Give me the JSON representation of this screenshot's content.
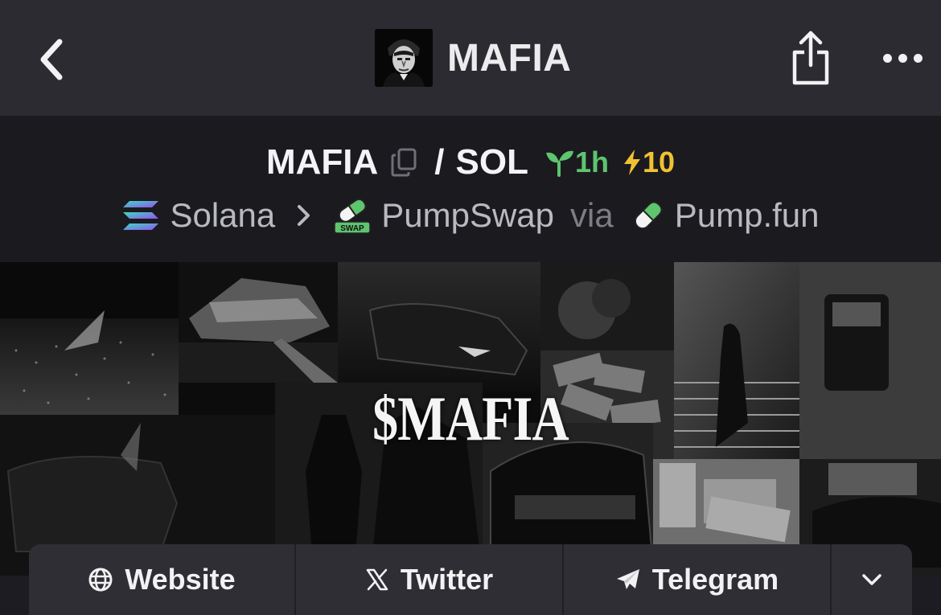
{
  "header": {
    "title": "MAFIA",
    "back_icon": "chevron-left-icon",
    "share_icon": "share-icon",
    "more_icon": "more-horizontal-icon"
  },
  "pair": {
    "base": "MAFIA",
    "separator": "/",
    "quote": "SOL",
    "age": "1h",
    "boosts": "10",
    "age_color": "#5fc46e",
    "boost_color": "#f0c232"
  },
  "chain": {
    "network": "Solana",
    "dex": "PumpSwap",
    "via_label": "via",
    "launchpad": "Pump.fun",
    "dex_badge": "SWAP"
  },
  "banner": {
    "text": "$MAFIA"
  },
  "links": {
    "website": "Website",
    "twitter": "Twitter",
    "telegram": "Telegram"
  }
}
